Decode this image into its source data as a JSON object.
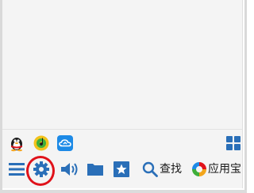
{
  "pinned_apps": [
    {
      "icon": "qq-penguin-icon"
    },
    {
      "icon": "music-disc-icon"
    },
    {
      "icon": "cloud-sync-icon"
    }
  ],
  "toolbar": {
    "search_label": "查找",
    "appstore_label": "应用宝",
    "items": [
      "menu-icon",
      "gear-icon",
      "speaker-icon",
      "folder-icon",
      "star-icon",
      "search-icon",
      "appstore-icon",
      "tiles-icon"
    ]
  },
  "colors": {
    "panel_bg": "#f4f4f4",
    "icon_blue": "#2a6fb8",
    "annotation_red": "#e0121a"
  }
}
